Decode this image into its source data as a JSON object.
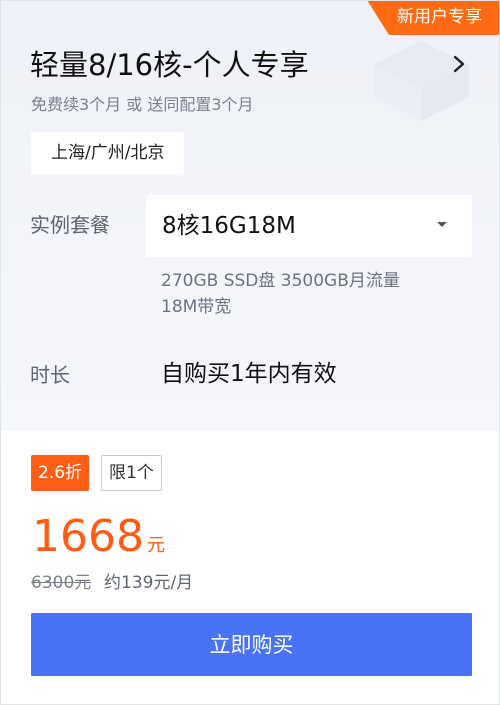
{
  "badge": "新用户专享",
  "title": "轻量8/16核-个人专享",
  "subtitle": "免费续3个月 或 送同配置3个月",
  "region": "上海/广州/北京",
  "plan": {
    "label": "实例套餐",
    "selected": "8核16G18M",
    "spec_line1": "270GB SSD盘 3500GB月流量",
    "spec_line2": "18M带宽"
  },
  "duration": {
    "label": "时长",
    "value": "自购买1年内有效"
  },
  "tags": {
    "discount": "2.6折",
    "limit": "限1个"
  },
  "price": {
    "amount": "1668",
    "unit": "元",
    "original": "6300元",
    "monthly": "约139元/月"
  },
  "buy_button": "立即购买",
  "icons": {
    "arrow": "chevron-right-icon",
    "caret": "caret-down-icon"
  },
  "colors": {
    "accent": "#ff5b12",
    "button": "#4a72f5",
    "badge": "#ff6a13"
  }
}
